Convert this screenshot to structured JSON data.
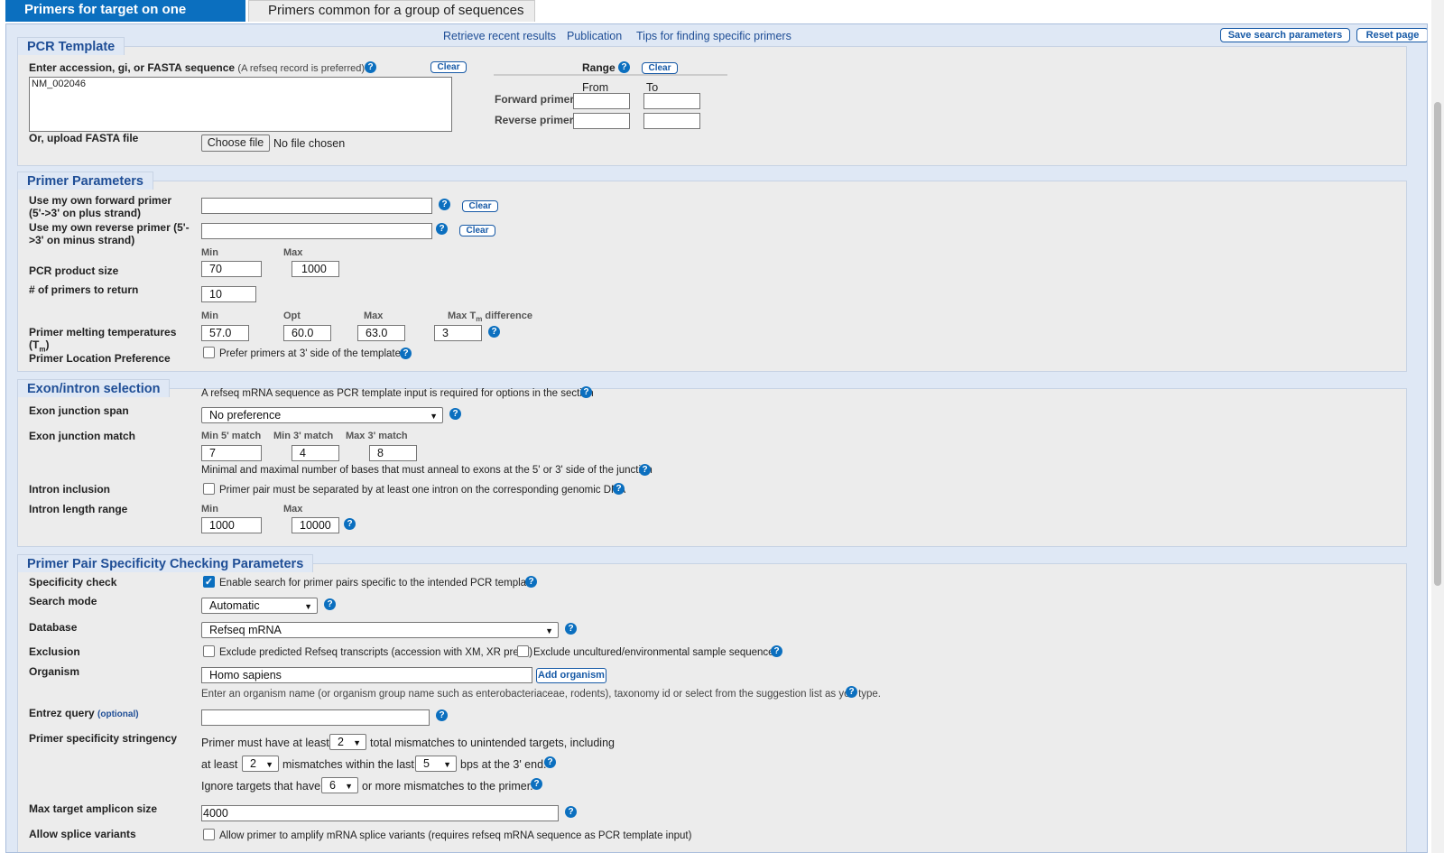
{
  "tabs": [
    {
      "label": "Primers for target on one template"
    },
    {
      "label": "Primers common for a group of sequences"
    }
  ],
  "top_links": {
    "retrieve": "Retrieve recent results",
    "publication": "Publication",
    "tips": "Tips for finding specific primers"
  },
  "top_buttons": {
    "save": "Save search parameters",
    "reset": "Reset page"
  },
  "pcr_template": {
    "legend": "PCR Template",
    "accession_label": "Enter accession, gi, or FASTA sequence",
    "accession_note": "(A refseq record is preferred)",
    "clear": "Clear",
    "sequence_value": "NM_002046",
    "range_label": "Range",
    "range_clear": "Clear",
    "from": "From",
    "to": "To",
    "forward_primer": "Forward primer",
    "reverse_primer": "Reverse primer",
    "upload_label": "Or, upload FASTA file",
    "choose_file": "Choose file",
    "no_file": "No file chosen"
  },
  "primer_params": {
    "legend": "Primer Parameters",
    "own_forward_1": "Use my own forward primer",
    "own_forward_2": "(5'->3' on plus strand)",
    "own_reverse_1": "Use my own reverse primer (5'-",
    "own_reverse_2": ">3' on minus strand)",
    "clear": "Clear",
    "min": "Min",
    "max": "Max",
    "opt": "Opt",
    "product_size_label": "PCR product size",
    "product_min": "70",
    "product_max": "1000",
    "num_primers_label": "# of primers to return",
    "num_primers": "10",
    "tm_label_1": "Primer melting temperatures",
    "tm_label_2": "(T",
    "tm_label_sub": "m",
    "tm_label_3": ")",
    "tm_diff_1": "Max T",
    "tm_diff_sub": "m",
    "tm_diff_2": " difference",
    "tm_min": "57.0",
    "tm_opt": "60.0",
    "tm_max": "63.0",
    "tm_diff": "3",
    "location_label": "Primer Location Preference",
    "location_option": "Prefer primers at 3' side of the template"
  },
  "exon_intron": {
    "legend": "Exon/intron selection",
    "note": "A refseq mRNA sequence as PCR template input is required for options in the section",
    "junction_span_label": "Exon junction span",
    "junction_span_value": "No preference",
    "junction_match_label": "Exon junction match",
    "min5": "Min 5' match",
    "min3": "Min 3' match",
    "max3": "Max 3' match",
    "min5_val": "7",
    "min3_val": "4",
    "max3_val": "8",
    "match_note": "Minimal and maximal number of bases that must anneal to exons at the 5' or 3' side of the junction",
    "intron_inclusion_label": "Intron inclusion",
    "intron_inclusion_option": "Primer pair must be separated by at least one intron on the corresponding genomic DNA",
    "intron_length_label": "Intron length range",
    "min": "Min",
    "max": "Max",
    "intron_min": "1000",
    "intron_max": "10000"
  },
  "specificity": {
    "legend": "Primer Pair Specificity Checking Parameters",
    "check_label": "Specificity check",
    "check_option": "Enable search for primer pairs specific to the intended PCR template",
    "search_mode_label": "Search mode",
    "search_mode_value": "Automatic",
    "database_label": "Database",
    "database_value": "Refseq mRNA",
    "exclusion_label": "Exclusion",
    "exclusion_opt1": "Exclude predicted Refseq transcripts (accession with XM, XR prefix)",
    "exclusion_opt2": "Exclude uncultured/environmental sample sequences",
    "organism_label": "Organism",
    "organism_value": "Homo sapiens",
    "add_organism": "Add organism",
    "organism_note": "Enter an organism name (or organism group name such as enterobacteriaceae, rodents), taxonomy id or select from the suggestion list as you type.",
    "entrez_label": "Entrez query",
    "entrez_optional": "(optional)",
    "stringency_label": "Primer specificity stringency",
    "str_line1a": "Primer must have at least",
    "str_total": "2",
    "str_line1b": "total mismatches to unintended targets, including",
    "str_line2a": "at least",
    "str_mis": "2",
    "str_line2b": "mismatches within the last",
    "str_last": "5",
    "str_line2c": "bps at the 3' end.",
    "str_line3a": "Ignore targets that have",
    "str_ignore": "6",
    "str_line3b": "or more mismatches to the primer.",
    "amplicon_label": "Max target amplicon size",
    "amplicon_value": "4000",
    "splice_label": "Allow splice variants",
    "splice_option": "Allow primer to amplify mRNA splice variants (requires refseq mRNA sequence as PCR template input)"
  },
  "colors": {
    "accent": "#0b6fbf",
    "link": "#1f4e96",
    "panel": "#ececec",
    "frame": "#dfe8f5"
  }
}
